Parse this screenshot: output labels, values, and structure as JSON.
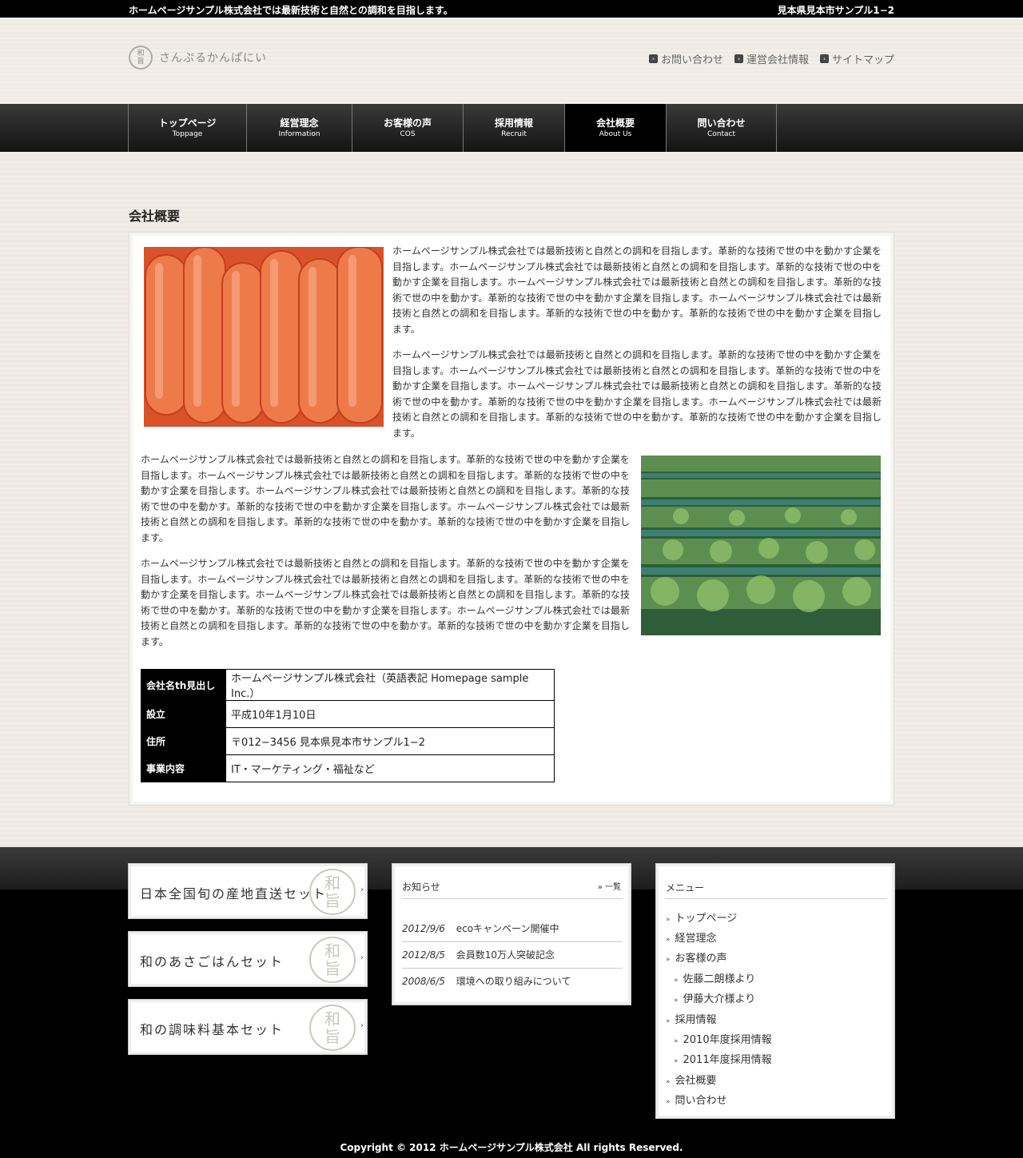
{
  "topbar": {
    "tagline": "ホームページサンプル株式会社では最新技術と自然との調和を目指します。",
    "address": "見本県見本市サンプル1−2"
  },
  "header": {
    "logo_seal_top": "和",
    "logo_seal_bottom": "旨",
    "logo_text": "さんぷるかんぱにい",
    "links": [
      {
        "label": "お問い合わせ",
        "icon": "arrow-square-icon"
      },
      {
        "label": "運営会社情報",
        "icon": "arrow-square-icon"
      },
      {
        "label": "サイトマップ",
        "icon": "arrow-square-icon"
      }
    ]
  },
  "nav": {
    "items": [
      {
        "jp": "トップページ",
        "en": "Toppage"
      },
      {
        "jp": "経営理念",
        "en": "Information"
      },
      {
        "jp": "お客様の声",
        "en": "COS"
      },
      {
        "jp": "採用情報",
        "en": "Recruit"
      },
      {
        "jp": "会社概要",
        "en": "About Us",
        "active": true
      },
      {
        "jp": "問い合わせ",
        "en": "Contact"
      }
    ]
  },
  "main": {
    "title": "会社概要",
    "paragraphs": [
      "ホームページサンプル株式会社では最新技術と自然との調和を目指します。革新的な技術で世の中を動かす企業を目指します。ホームページサンプル株式会社では最新技術と自然との調和を目指します。革新的な技術で世の中を動かす企業を目指します。ホームページサンプル株式会社では最新技術と自然との調和を目指します。革新的な技術で世の中を動かす。革新的な技術で世の中を動かす企業を目指します。ホームページサンプル株式会社では最新技術と自然との調和を目指します。革新的な技術で世の中を動かす。革新的な技術で世の中を動かす企業を目指します。",
      "ホームページサンプル株式会社では最新技術と自然との調和を目指します。革新的な技術で世の中を動かす企業を目指します。ホームページサンプル株式会社では最新技術と自然との調和を目指します。革新的な技術で世の中を動かす企業を目指します。ホームページサンプル株式会社では最新技術と自然との調和を目指します。革新的な技術で世の中を動かす。革新的な技術で世の中を動かす企業を目指します。ホームページサンプル株式会社では最新技術と自然との調和を目指します。革新的な技術で世の中を動かす。革新的な技術で世の中を動かす企業を目指します。",
      "ホームページサンプル株式会社では最新技術と自然との調和を目指します。革新的な技術で世の中を動かす企業を目指します。ホームページサンプル株式会社では最新技術と自然との調和を目指します。革新的な技術で世の中を動かす企業を目指します。ホームページサンプル株式会社では最新技術と自然との調和を目指します。革新的な技術で世の中を動かす。革新的な技術で世の中を動かす企業を目指します。ホームページサンプル株式会社では最新技術と自然との調和を目指します。革新的な技術で世の中を動かす。革新的な技術で世の中を動かす企業を目指します。",
      "ホームページサンプル株式会社では最新技術と自然との調和を目指します。革新的な技術で世の中を動かす企業を目指します。ホームページサンプル株式会社では最新技術と自然との調和を目指します。革新的な技術で世の中を動かす企業を目指します。ホームページサンプル株式会社では最新技術と自然との調和を目指します。革新的な技術で世の中を動かす。革新的な技術で世の中を動かす企業を目指します。ホームページサンプル株式会社では最新技術と自然との調和を目指します。革新的な技術で世の中を動かす。革新的な技術で世の中を動かす企業を目指します。"
    ],
    "table": [
      {
        "th": "会社名th見出し",
        "td": "ホームページサンプル株式会社（英語表記 Homepage sample Inc.）"
      },
      {
        "th": "設立",
        "td": "平成10年1月10日"
      },
      {
        "th": "住所",
        "td": "〒012−3456 見本県見本市サンプル1−2"
      },
      {
        "th": "事業内容",
        "td": "IT・マーケティング・福祉など"
      }
    ]
  },
  "footer": {
    "banners": [
      {
        "label": "日本全国旬の産地直送セット",
        "seal_top": "和",
        "seal_bottom": "旨"
      },
      {
        "label": "和のあさごはんセット",
        "seal_top": "和",
        "seal_bottom": "旨"
      },
      {
        "label": "和の調味料基本セット",
        "seal_top": "和",
        "seal_bottom": "旨"
      }
    ],
    "news": {
      "title": "お知らせ",
      "more": "一覧",
      "items": [
        {
          "date": "2012/9/6",
          "text": "ecoキャンペーン開催中"
        },
        {
          "date": "2012/8/5",
          "text": "会員数10万人突破記念"
        },
        {
          "date": "2008/6/5",
          "text": "環境への取り組みについて"
        }
      ]
    },
    "menu": {
      "title": "メニュー",
      "items": [
        {
          "label": "トップページ",
          "level": 0
        },
        {
          "label": "経営理念",
          "level": 0
        },
        {
          "label": "お客様の声",
          "level": 0
        },
        {
          "label": "佐藤二朗様より",
          "level": 1
        },
        {
          "label": "伊藤大介様より",
          "level": 1
        },
        {
          "label": "採用情報",
          "level": 0
        },
        {
          "label": "2010年度採用情報",
          "level": 1
        },
        {
          "label": "2011年度採用情報",
          "level": 1
        },
        {
          "label": "会社概要",
          "level": 0
        },
        {
          "label": "問い合わせ",
          "level": 0
        }
      ]
    },
    "copyright": "Copyright © 2012 ホームページサンプル株式会社 All rights Reserved."
  }
}
